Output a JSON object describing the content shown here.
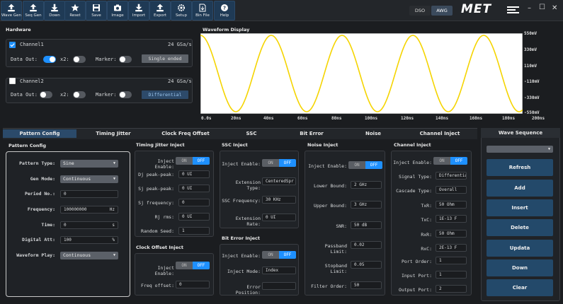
{
  "toolbar": {
    "items": [
      {
        "label": "Wave Gen",
        "icon": "upload-icon"
      },
      {
        "label": "Seq Gen",
        "icon": "upload-icon"
      },
      {
        "label": "Down",
        "icon": "download-icon"
      },
      {
        "label": "Reset",
        "icon": "star-icon"
      },
      {
        "label": "Save",
        "icon": "save-icon"
      },
      {
        "label": "Image",
        "icon": "camera-icon"
      },
      {
        "label": "Import",
        "icon": "import-icon"
      },
      {
        "label": "Export",
        "icon": "export-icon"
      },
      {
        "label": "Setup",
        "icon": "gear-icon"
      },
      {
        "label": "Bin File",
        "icon": "file-icon"
      },
      {
        "label": "Help",
        "icon": "help-icon"
      }
    ],
    "mode_dso": "DSO",
    "mode_awg": "AWG",
    "logo": "MET"
  },
  "hardware": {
    "title": "Hardware",
    "ch1": {
      "label": "Channel1",
      "rate": "24 GSa/s",
      "data_out": "Data Out:",
      "x2": "x2:",
      "marker": "Marker:",
      "mode": "Single ended"
    },
    "ch2": {
      "label": "Channel2",
      "rate": "24 GSa/s",
      "data_out": "Data Out:",
      "x2": "x2:",
      "marker": "Marker:",
      "mode": "Differential"
    }
  },
  "waveform": {
    "title": "Waveform Display",
    "y_ticks": [
      "550mV",
      "330mV",
      "110mV",
      "-110mV",
      "-330mV",
      "-550mV"
    ],
    "x_ticks": [
      "0.0s",
      "20ns",
      "40ns",
      "60ns",
      "80ns",
      "100ns",
      "120ns",
      "140ns",
      "160ns",
      "180ns",
      "200ns"
    ]
  },
  "tabs": [
    "Pattern Config",
    "Timing Jitter",
    "Clock Freq Offset",
    "SSC",
    "Bit Error",
    "Noise",
    "Channel Inject"
  ],
  "pattern": {
    "title": "Pattern Config",
    "type_label": "Pattern Type:",
    "type_value": "Sine",
    "gen_label": "Gen Mode:",
    "gen_value": "Continuous",
    "period_label": "Period No.:",
    "period_value": "0",
    "freq_label": "Frequency:",
    "freq_value": "100000000",
    "freq_unit": "Hz",
    "time_label": "Time:",
    "time_value": "0",
    "time_unit": "s",
    "att_label": "Digital Att:",
    "att_value": "100",
    "att_unit": "%",
    "play_label": "Waveform Play:",
    "play_value": "Continuous"
  },
  "timing": {
    "title": "Timing Jitter Inject",
    "enable": "Inject Enable:",
    "on": "ON",
    "off": "OFF",
    "rows": [
      {
        "label": "Dj peak-peak:",
        "value": "0 UI"
      },
      {
        "label": "Sj peak-peak:",
        "value": "0 UI"
      },
      {
        "label": "Sj frequency:",
        "value": "0"
      },
      {
        "label": "Rj rms:",
        "value": "0 UI"
      },
      {
        "label": "Random Seed:",
        "value": "1"
      }
    ]
  },
  "clock": {
    "title": "Clock Offset Inject",
    "enable": "Inject Enable:",
    "on": "ON",
    "off": "OFF",
    "freq_label": "Freq offset:",
    "freq_value": "0"
  },
  "ssc": {
    "title": "SSC Inject",
    "enable": "Inject Enable:",
    "on": "ON",
    "off": "OFF",
    "rows": [
      {
        "label": "Extension Type:",
        "value": "CenteredSpr"
      },
      {
        "label": "SSC Frequency:",
        "value": "30 KHz"
      },
      {
        "label": "Extension Rate:",
        "value": "0 UI"
      }
    ]
  },
  "biterr": {
    "title": "Bit Error Inject",
    "enable": "Inject Enable:",
    "on": "ON",
    "off": "OFF",
    "mode_label": "Inject Mode:",
    "mode_value": "Index",
    "pos_label": "Error Position:",
    "pos_value": ""
  },
  "noise": {
    "title": "Noise Inject",
    "enable": "Inject Enable:",
    "on": "ON",
    "off": "OFF",
    "rows": [
      {
        "label": "Lower Bound:",
        "value": "2 GHz"
      },
      {
        "label": "Upper Bound:",
        "value": "3 GHz"
      },
      {
        "label": "SNR:",
        "value": "50 dB"
      },
      {
        "label": "Passband Limit:",
        "value": "0.02"
      },
      {
        "label": "Stopband Limit:",
        "value": "0.05"
      },
      {
        "label": "Filter Order:",
        "value": "50"
      }
    ]
  },
  "chinj": {
    "title": "Channel Inject",
    "enable": "Inject Enable:",
    "on": "ON",
    "off": "OFF",
    "rows": [
      {
        "label": "Signal Type:",
        "value": "Differentia"
      },
      {
        "label": "Cascade Type:",
        "value": "Overall"
      },
      {
        "label": "TxR:",
        "value": "50 Ohm"
      },
      {
        "label": "TxC:",
        "value": "1E-13 F"
      },
      {
        "label": "RxR:",
        "value": "50 Ohm"
      },
      {
        "label": "RxC:",
        "value": "2E-13 F"
      },
      {
        "label": "Port Order:",
        "value": "1"
      },
      {
        "label": "Input Port:",
        "value": "1"
      },
      {
        "label": "Output Port:",
        "value": "2"
      }
    ]
  },
  "sequence": {
    "title": "Wave Sequence",
    "select": "",
    "buttons": [
      "Refresh",
      "Add",
      "Insert",
      "Delete",
      "Updata",
      "Down",
      "Clear"
    ]
  },
  "colors": {
    "accent": "#1e90ff",
    "wave": "#f5d400",
    "toolbar_btn": "#1f3a55"
  }
}
